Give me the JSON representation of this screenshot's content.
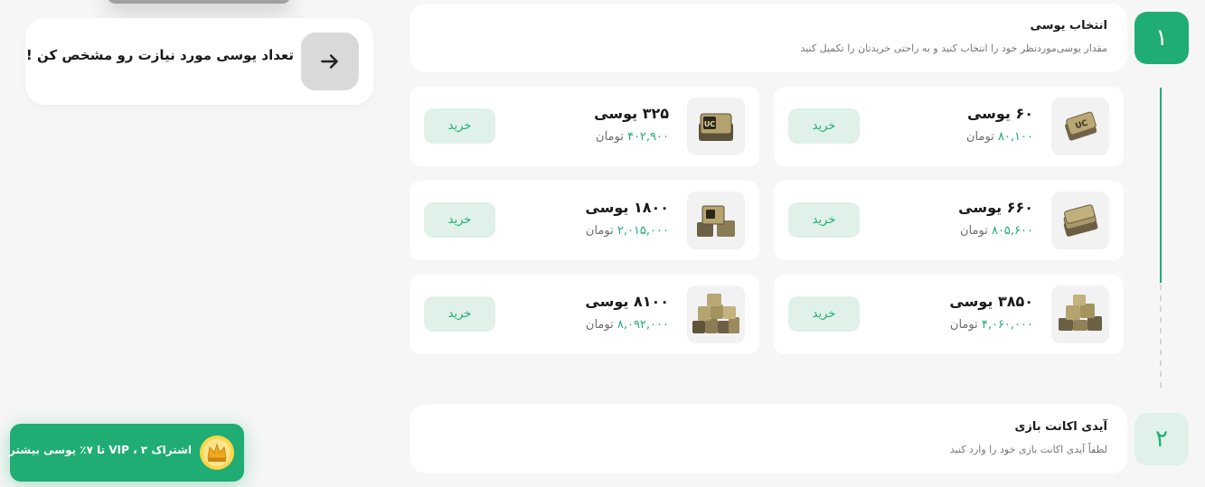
{
  "hint": {
    "text": "تعداد یوسی مورد نیازت رو مشخص کن !",
    "icon": "arrow-right-icon"
  },
  "steps": [
    {
      "number": "۱",
      "title": "انتخاب یوسی",
      "subtitle": "مقدار یوسی‌موردنظر خود را انتخاب کنید و به راحتی خریدتان را تکمیل کنید"
    },
    {
      "number": "۲",
      "title": "آیدی اکانت بازی",
      "subtitle": "لطفاً آیدی اکانت بازی خود را وارد کنید"
    }
  ],
  "packages": [
    {
      "amount": "۶۰ یوسی",
      "price": "۸۰,۱۰۰",
      "currency": "تومان",
      "buy": "خرید",
      "icon": "uc-pack-small-icon"
    },
    {
      "amount": "۳۲۵ یوسی",
      "price": "۴۰۲,۹۰۰",
      "currency": "تومان",
      "buy": "خرید",
      "icon": "uc-pack-icon"
    },
    {
      "amount": "۶۶۰ یوسی",
      "price": "۸۰۵,۶۰۰",
      "currency": "تومان",
      "buy": "خرید",
      "icon": "uc-bundle-icon"
    },
    {
      "amount": "۱۸۰۰ یوسی",
      "price": "۲,۰۱۵,۰۰۰",
      "currency": "تومان",
      "buy": "خرید",
      "icon": "uc-stack-icon"
    },
    {
      "amount": "۳۸۵۰ یوسی",
      "price": "۴,۰۶۰,۰۰۰",
      "currency": "تومان",
      "buy": "خرید",
      "icon": "uc-crates-icon"
    },
    {
      "amount": "۸۱۰۰ یوسی",
      "price": "۸,۰۹۲,۰۰۰",
      "currency": "تومان",
      "buy": "خرید",
      "icon": "uc-pile-icon"
    }
  ],
  "vip": {
    "text": "اشتراک VIP ، ۳ تا ۷٪ یوسی بیشتر",
    "icon": "crown-icon"
  },
  "colors": {
    "accent": "#1fad74",
    "accent_soft": "#dff1e9",
    "background": "#f6f6f6"
  }
}
